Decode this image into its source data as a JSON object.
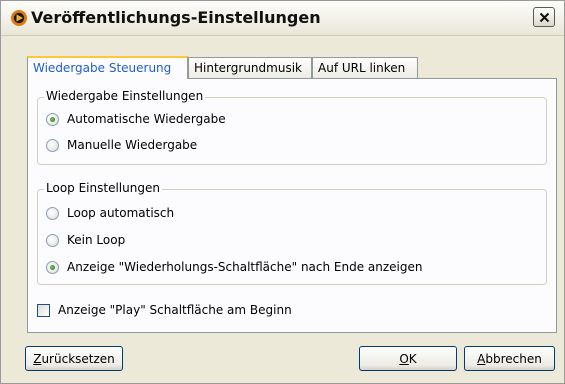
{
  "window": {
    "title": "Veröffentlichungs-Einstellungen",
    "close_label": "x"
  },
  "tabs": [
    {
      "label": "Wiedergabe Steuerung",
      "active": true
    },
    {
      "label": "Hintergrundmusik",
      "active": false
    },
    {
      "label": "Auf URL linken",
      "active": false
    }
  ],
  "playback_group": {
    "legend": "Wiedergabe Einstellungen",
    "options": [
      {
        "label": "Automatische Wiedergabe",
        "checked": true
      },
      {
        "label": "Manuelle Wiedergabe",
        "checked": false
      }
    ]
  },
  "loop_group": {
    "legend": "Loop Einstellungen",
    "options": [
      {
        "label": "Loop automatisch",
        "checked": false
      },
      {
        "label": "Kein Loop",
        "checked": false
      },
      {
        "label": "Anzeige \"Wiederholungs-Schaltfläche\" nach Ende anzeigen",
        "checked": true
      }
    ]
  },
  "play_button_checkbox": {
    "label": "Anzeige \"Play\" Schaltfläche am Beginn",
    "checked": false
  },
  "buttons": {
    "reset_first": "Z",
    "reset_rest": "urücksetzen",
    "ok_first": "O",
    "ok_rest": "K",
    "cancel_first": "A",
    "cancel_rest": "bbrechen"
  }
}
